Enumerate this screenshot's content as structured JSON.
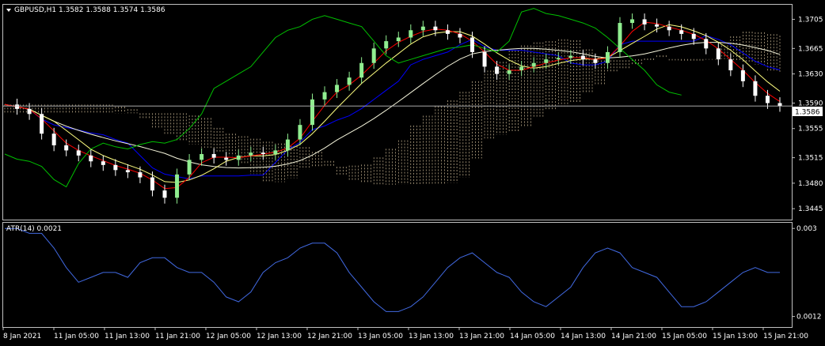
{
  "header": {
    "symbol_line": "GBPUSD,H1  1.3582 1.3588 1.3574 1.3586",
    "indicator_line": "ATR(14) 0.0021"
  },
  "price_axis": {
    "labels": [
      "1.3705",
      "1.3665",
      "1.3630",
      "1.3590",
      "1.3555",
      "1.3515",
      "1.3480",
      "1.3445"
    ],
    "current_price": "1.3586",
    "current_value": 1.3586
  },
  "indicator_axis": {
    "labels": [
      "0.003",
      "0.0012"
    ]
  },
  "time_axis": {
    "labels": [
      "8 Jan 2021",
      "11 Jan 05:00",
      "11 Jan 13:00",
      "11 Jan 21:00",
      "12 Jan 05:00",
      "12 Jan 13:00",
      "12 Jan 21:00",
      "13 Jan 05:00",
      "13 Jan 13:00",
      "13 Jan 21:00",
      "14 Jan 05:00",
      "14 Jan 13:00",
      "14 Jan 21:00",
      "15 Jan 05:00",
      "15 Jan 13:00",
      "15 Jan 21:00"
    ]
  },
  "colors": {
    "background": "#000000",
    "bull_candle": "#90ee90",
    "bear_candle": "#ffffff",
    "fast_ma": "#ff0000",
    "slow_ma": "#ffff80",
    "long_ma": "#f5f5dc",
    "kijun": "#0000ff",
    "chikou": "#00c000",
    "cloud": "#f5deb3",
    "atr": "#4169e1",
    "grid_border": "#c0c0c0"
  },
  "chart_data": [
    {
      "type": "candlestick",
      "title": "GBPUSD,H1",
      "symbol": "GBPUSD",
      "timeframe": "H1",
      "last_bar": {
        "open": 1.3582,
        "high": 1.3588,
        "low": 1.3574,
        "close": 1.3586
      },
      "ylim": [
        1.343,
        1.3725
      ],
      "price_series_approx": [
        1.3588,
        1.3582,
        1.3575,
        1.3548,
        1.3532,
        1.3525,
        1.3518,
        1.351,
        1.3505,
        1.3498,
        1.3495,
        1.3488,
        1.347,
        1.346,
        1.3492,
        1.3512,
        1.352,
        1.3515,
        1.3512,
        1.3518,
        1.3522,
        1.352,
        1.3525,
        1.354,
        1.356,
        1.3595,
        1.3605,
        1.3615,
        1.3625,
        1.3645,
        1.3665,
        1.3675,
        1.368,
        1.369,
        1.3695,
        1.369,
        1.3685,
        1.368,
        1.366,
        1.364,
        1.363,
        1.3635,
        1.364,
        1.3645,
        1.365,
        1.3652,
        1.3655,
        1.365,
        1.3645,
        1.366,
        1.37,
        1.3705,
        1.3698,
        1.3695,
        1.369,
        1.3685,
        1.3678,
        1.3665,
        1.365,
        1.3635,
        1.362,
        1.36,
        1.359,
        1.3586
      ],
      "overlays": [
        "moving averages (red, yellow, white)",
        "Ichimoku (blue, green, dotted cloud)"
      ]
    },
    {
      "type": "line",
      "title": "ATR(14) 0.0021",
      "name": "ATR(14)",
      "ylim": [
        0.001,
        0.0031
      ],
      "values_approx": [
        0.003,
        0.003,
        0.0029,
        0.0029,
        0.0026,
        0.0022,
        0.0019,
        0.002,
        0.0021,
        0.0021,
        0.002,
        0.0023,
        0.0024,
        0.0024,
        0.0022,
        0.0021,
        0.0021,
        0.0019,
        0.0016,
        0.0015,
        0.0017,
        0.0021,
        0.0023,
        0.0024,
        0.0026,
        0.0027,
        0.0027,
        0.0025,
        0.0021,
        0.0018,
        0.0015,
        0.0013,
        0.0013,
        0.0014,
        0.0016,
        0.0019,
        0.0022,
        0.0024,
        0.0025,
        0.0023,
        0.0021,
        0.002,
        0.0017,
        0.0015,
        0.0014,
        0.0016,
        0.0018,
        0.0022,
        0.0025,
        0.0026,
        0.0025,
        0.0022,
        0.0021,
        0.002,
        0.0017,
        0.0014,
        0.0014,
        0.0015,
        0.0017,
        0.0019,
        0.0021,
        0.0022,
        0.0021,
        0.0021
      ]
    }
  ]
}
